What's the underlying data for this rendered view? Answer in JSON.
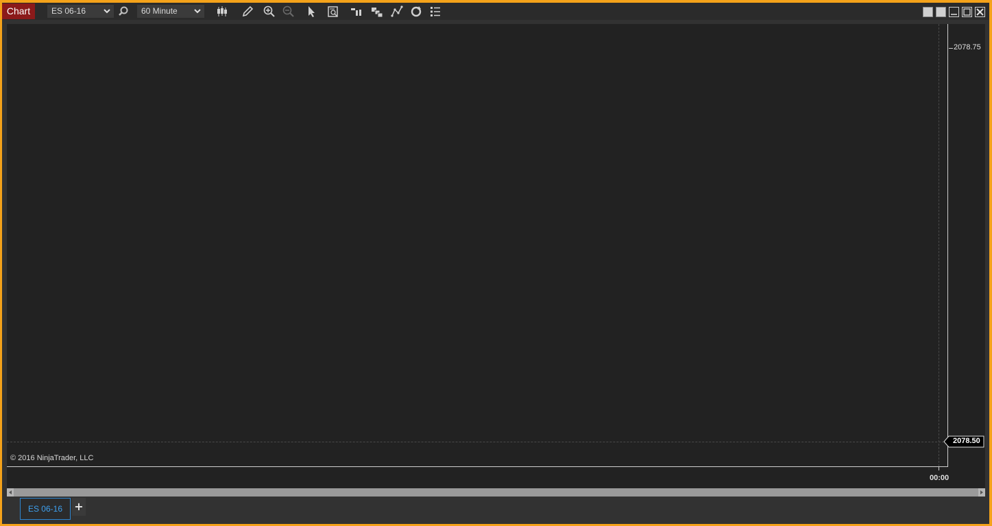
{
  "window": {
    "title": "Chart",
    "instrument": "ES 06-16",
    "interval": "60 Minute"
  },
  "toolbar": {
    "icons": [
      "bar-type-icon",
      "drawing-tool-icon",
      "zoom-in-icon",
      "zoom-out-icon",
      "pointer-icon",
      "data-box-icon",
      "chart-trader-icon",
      "templates-icon",
      "strategies-icon",
      "reload-icon",
      "properties-icon"
    ]
  },
  "chart": {
    "copyright": "© 2016 NinjaTrader, LLC",
    "y_labels": [
      "2078.75"
    ],
    "last_price": "2078.50",
    "x_label": "00:00"
  },
  "tabs": [
    {
      "label": "ES 06-16"
    }
  ],
  "add_tab_label": "+",
  "colors": {
    "outer_background": "#f4a21a",
    "title_accent": "#8b1a1a",
    "chart_background": "#222222",
    "tab_accent": "#3ea0ef"
  }
}
